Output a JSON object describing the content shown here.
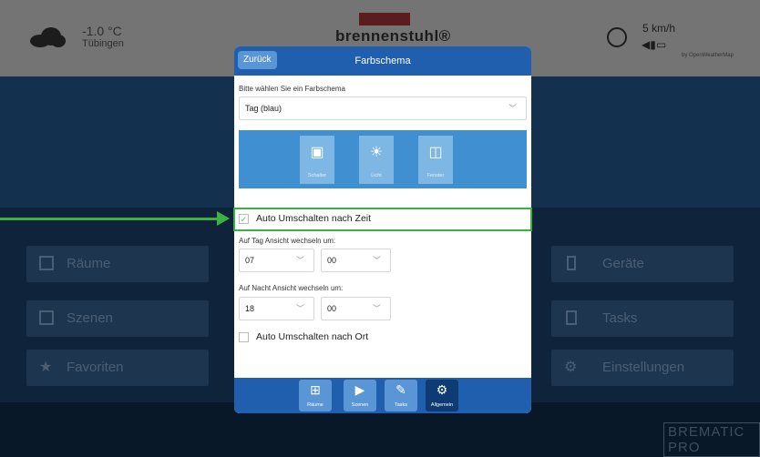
{
  "background": {
    "weather": {
      "temperature": "-1.0 °C",
      "city": "Tübingen"
    },
    "brand": "brennenstuhl®",
    "wind": {
      "speed": "5 km/h",
      "attribution": "by OpenWeatherMap"
    },
    "tiles_left": [
      {
        "label": "Räume",
        "icon": "rooms-icon"
      },
      {
        "label": "Szenen",
        "icon": "scenes-icon"
      },
      {
        "label": "Favoriten",
        "icon": "star-icon"
      }
    ],
    "tiles_right": [
      {
        "label": "Geräte",
        "icon": "plug-icon"
      },
      {
        "label": "Tasks",
        "icon": "tasks-icon"
      },
      {
        "label": "Einstellungen",
        "icon": "gears-icon"
      }
    ],
    "footer_logo": "BREMATIC PRO"
  },
  "dialog": {
    "back_label": "Zurück",
    "title": "Farbschema",
    "scheme_prompt": "Bitte wählen Sie ein Farbschema",
    "scheme_value": "Tag (blau)",
    "preview_items": [
      {
        "label": "Schalter",
        "icon": "switch-icon"
      },
      {
        "label": "Licht",
        "icon": "bulb-icon"
      },
      {
        "label": "Fenster",
        "icon": "window-icon"
      }
    ],
    "auto_time": {
      "label": "Auto Umschalten nach Zeit",
      "checked": true
    },
    "day_label": "Auf Tag Ansicht wechseln um:",
    "day_hour": "07",
    "day_minute": "00",
    "night_label": "Auf Nacht Ansicht wechseln um:",
    "night_hour": "18",
    "night_minute": "00",
    "auto_location": {
      "label": "Auto Umschalten nach Ort",
      "checked": false
    },
    "tabs": [
      {
        "label": "Räume",
        "icon": "rooms-icon",
        "active": false
      },
      {
        "label": "Szenen",
        "icon": "scenes-icon",
        "active": false
      },
      {
        "label": "Tasks",
        "icon": "tasks-icon",
        "active": false
      },
      {
        "label": "Allgemein",
        "icon": "gears-icon",
        "active": true
      }
    ]
  },
  "colors": {
    "header_blue": "#1f5fae",
    "tab_blue": "#5a95d6",
    "highlight_green": "#3cb043"
  }
}
